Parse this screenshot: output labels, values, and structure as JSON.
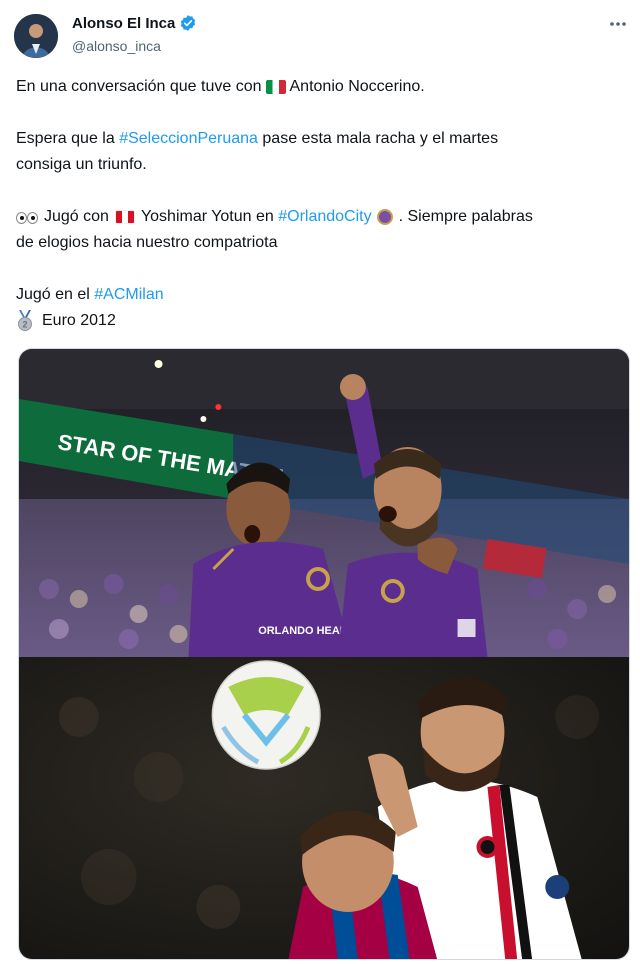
{
  "author": {
    "name": "Alonso El Inca",
    "handle": "@alonso_inca"
  },
  "tweet": {
    "line1_prefix": "En una conversación que tuve con",
    "line1_suffix": "Antonio Noccerino.",
    "line2_prefix": "Espera que la ",
    "line2_hashtag": "#SeleccionPeruana",
    "line2_suffix": " pase esta mala racha y el martes",
    "line3": "consiga un triunfo.",
    "line4_prefix": "Jugó con",
    "line4_name": "Yoshimar Yotun en ",
    "line4_hashtag": "#OrlandoCity",
    "line4_suffix": ". Siempre palabras",
    "line5": "de elogios hacia nuestro compatriota",
    "line6_prefix": "Jugó en el ",
    "line6_hashtag": "#ACMilan",
    "line7": "Euro 2012"
  },
  "media": {
    "top_banner_text": "STAR OF THE MATCH"
  },
  "icons": {
    "verified": "verified-badge-icon",
    "more": "more-options-icon",
    "flag_italy": "italy-flag-icon",
    "flag_peru": "peru-flag-icon",
    "eyes": "eyes-emoji-icon",
    "orlando": "orlando-city-emoji-icon",
    "medal": "silver-medal-icon"
  },
  "colors": {
    "hashtag": "#1d9bf0",
    "verified": "#1d9bf0",
    "orlando_purple": "#5b2d8e"
  }
}
